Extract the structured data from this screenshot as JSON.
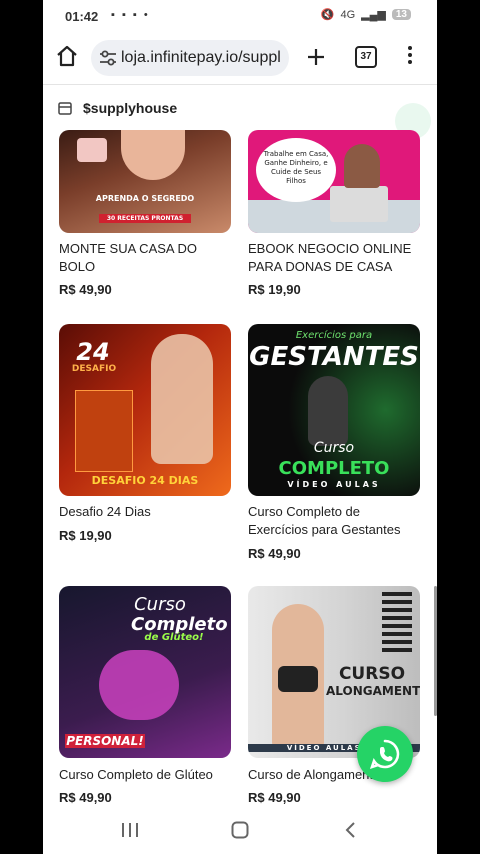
{
  "status_bar": {
    "time": "01:42",
    "left_icons": "▪ ▪ ▪ •",
    "signal": "4G",
    "battery": "13"
  },
  "browser": {
    "url": "loja.infinitepay.io/suppl",
    "tab_count": "37"
  },
  "store": {
    "name": "$supplyhouse"
  },
  "products": [
    {
      "title": "MONTE SUA CASA DO BOLO",
      "price": "R$ 49,90",
      "image_text": "APRENDA O SEGREDO",
      "image_sub": "30 RECEITAS PRONTAS"
    },
    {
      "title": "EBOOK NEGOCIO ONLINE PARA DONAS DE CASA",
      "price": "R$ 19,90",
      "image_text": "Trabalhe em Casa, Ganhe Dinheiro, e Cuide de Seus Filhos"
    },
    {
      "title": "Desafio 24 Dias",
      "price": "R$ 19,90",
      "image_text": "24",
      "image_label": "DESAFIO",
      "image_sub": "DESAFIO 24 DIAS"
    },
    {
      "title": "Curso Completo de Exercícios para Gestantes",
      "price": "R$ 49,90",
      "image_text": "GESTANTES",
      "image_top": "Exercícios para",
      "image_mid": "Curso",
      "image_label": "COMPLETO",
      "image_sub": "VÍDEO AULAS"
    },
    {
      "title": "Curso Completo de Glúteo",
      "price": "R$ 49,90",
      "image_text": "Curso",
      "image_label": "Completo",
      "image_mid": "de Glúteo!",
      "image_sub": "PERSONAL!"
    },
    {
      "title": "Curso de Alongamento",
      "price": "R$ 49,90",
      "image_text": "CURSO",
      "image_label": "ALONGAMENTO",
      "image_sub": "VÍDEO AULAS CO"
    }
  ],
  "colors": {
    "whatsapp": "#25d366",
    "pink": "#e0187a"
  },
  "icons": {
    "home": "home-icon",
    "plus": "plus-icon",
    "menu": "more-vert-icon",
    "whatsapp": "whatsapp-icon"
  }
}
